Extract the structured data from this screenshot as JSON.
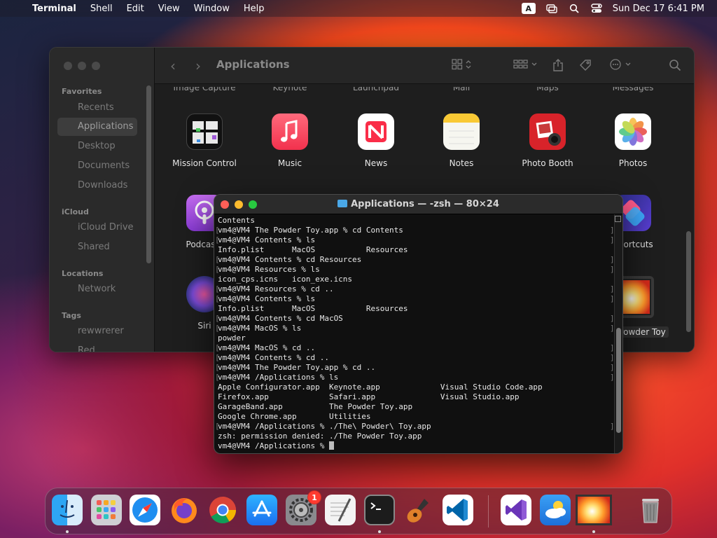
{
  "menubar": {
    "app_name": "Terminal",
    "items": [
      "Shell",
      "Edit",
      "View",
      "Window",
      "Help"
    ],
    "input_badge": "A",
    "clock": "Sun Dec 17  6:41 PM"
  },
  "finder": {
    "title": "Applications",
    "sidebar": {
      "favorites_label": "Favorites",
      "favorites": [
        "Recents",
        "Applications",
        "Desktop",
        "Documents",
        "Downloads"
      ],
      "icloud_label": "iCloud",
      "icloud": [
        "iCloud Drive",
        "Shared"
      ],
      "locations_label": "Locations",
      "locations": [
        "Network"
      ],
      "tags_label": "Tags",
      "tags": [
        "rewwrerer",
        "Red"
      ]
    },
    "cut_top_labels": [
      "Image Capture",
      "Keynote",
      "Launchpad",
      "Mail",
      "Maps",
      "Messages"
    ],
    "apps_row1": [
      "Mission Control",
      "Music",
      "News",
      "Notes",
      "Photo Booth",
      "Photos"
    ],
    "apps_partial": [
      "Podcasts",
      "Shortcuts",
      "Siri",
      "The Powder Toy"
    ]
  },
  "terminal": {
    "title": "Applications — -zsh — 80×24",
    "lines": [
      "Contents",
      "vm4@VM4 The Powder Toy.app % cd Contents",
      "vm4@VM4 Contents % ls",
      "Info.plist      MacOS           Resources",
      "vm4@VM4 Contents % cd Resources",
      "vm4@VM4 Resources % ls",
      "icon_cps.icns   icon_exe.icns",
      "vm4@VM4 Resources % cd ..",
      "vm4@VM4 Contents % ls",
      "Info.plist      MacOS           Resources",
      "vm4@VM4 Contents % cd MacOS",
      "vm4@VM4 MacOS % ls",
      "powder",
      "vm4@VM4 MacOS % cd ..",
      "vm4@VM4 Contents % cd ..",
      "vm4@VM4 The Powder Toy.app % cd ..",
      "vm4@VM4 /Applications % ls",
      "Apple Configurator.app  Keynote.app             Visual Studio Code.app",
      "Firefox.app             Safari.app              Visual Studio.app",
      "GarageBand.app          The Powder Toy.app",
      "Google Chrome.app       Utilities",
      "vm4@VM4 /Applications % ./The\\ Powder\\ Toy.app",
      "zsh: permission denied: ./The Powder Toy.app",
      "vm4@VM4 /Applications % "
    ]
  },
  "dock": {
    "apps": [
      "Finder",
      "Launchpad",
      "Safari",
      "Firefox",
      "Google Chrome",
      "App Store",
      "System Settings",
      "TextEdit",
      "Terminal",
      "GarageBand",
      "Visual Studio Code",
      "Visual Studio",
      "Weather",
      "The Powder Toy",
      "Trash"
    ],
    "settings_badge": "1"
  }
}
